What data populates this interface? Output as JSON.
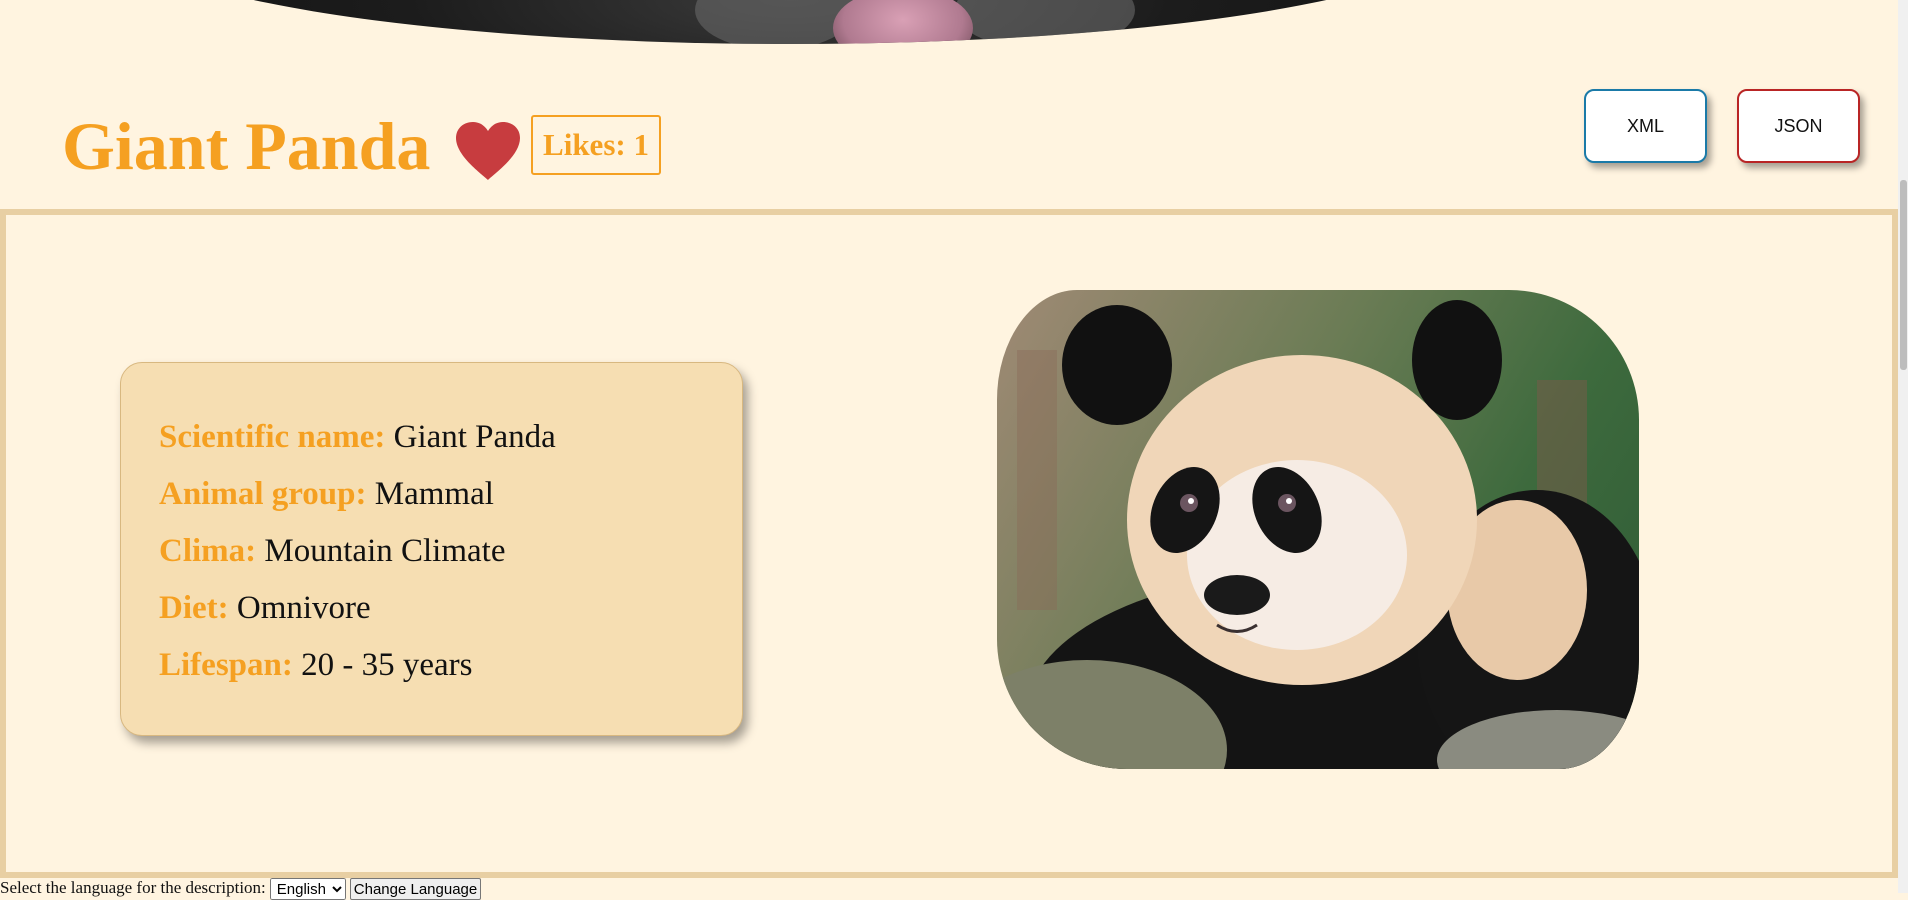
{
  "header": {
    "title": "Giant Panda",
    "likes_label": "Likes: 1"
  },
  "buttons": {
    "xml": "XML",
    "json": "JSON"
  },
  "info": {
    "rows": [
      {
        "label": "Scientific name:",
        "value": "Giant Panda"
      },
      {
        "label": "Animal group:",
        "value": "Mammal"
      },
      {
        "label": "Clima:",
        "value": "Mountain Climate"
      },
      {
        "label": "Diet:",
        "value": "Omnivore"
      },
      {
        "label": "Lifespan:",
        "value": "20 - 35 years"
      }
    ]
  },
  "language": {
    "prompt": "Select the language for the description:",
    "selected": "English",
    "button": "Change Language"
  },
  "colors": {
    "accent": "#f5a021",
    "heart": "#c73c3f",
    "background": "#fff4e0",
    "card": "#f6deb2",
    "xml_border": "#1a7aa8",
    "json_border": "#b92525"
  },
  "icons": {
    "like": "heart-icon",
    "hero": "animal-photo",
    "main": "panda-photo"
  }
}
